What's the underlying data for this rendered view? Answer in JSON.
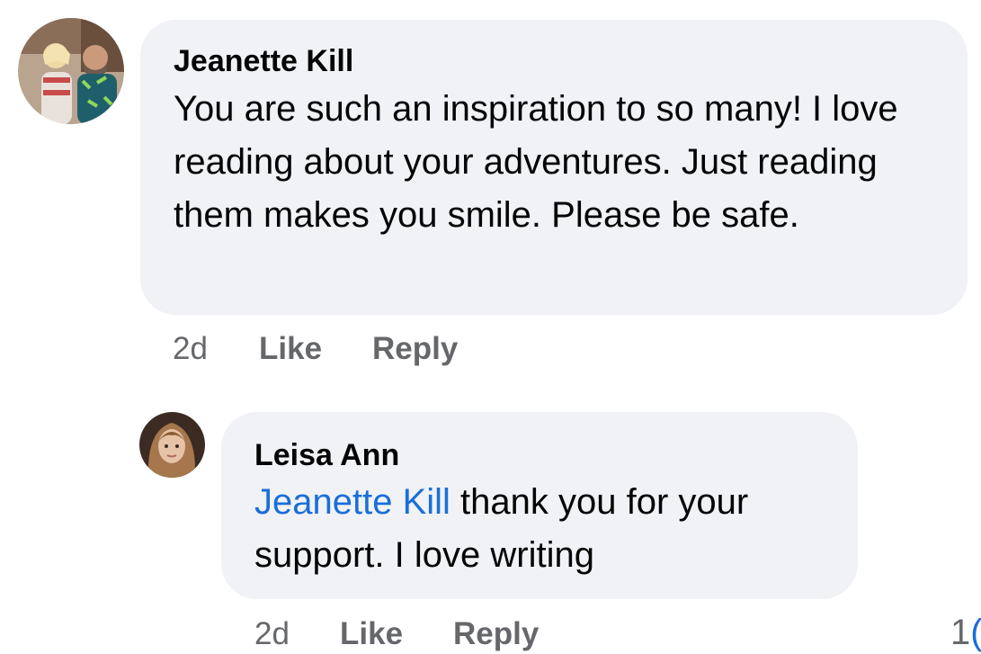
{
  "comments": [
    {
      "author": "Jeanette Kill",
      "text": "You are such an inspiration to so many! I love reading about your adventures. Just reading them makes you smile. Please be safe.",
      "time": "2d",
      "like_label": "Like",
      "reply_label": "Reply",
      "avatar": "avatar-couple-photo"
    },
    {
      "author": "Leisa Ann",
      "mention": "Jeanette Kill",
      "text": " thank you for your support.  I love writing",
      "time": "2d",
      "like_label": "Like",
      "reply_label": "Reply",
      "avatar": "avatar-woman-photo"
    }
  ],
  "reaction_count_partial": "1",
  "colors": {
    "bubble_bg": "#f0f2f5",
    "mention": "#1a6ed8",
    "meta_text": "#65676b",
    "body_text": "#050505"
  }
}
